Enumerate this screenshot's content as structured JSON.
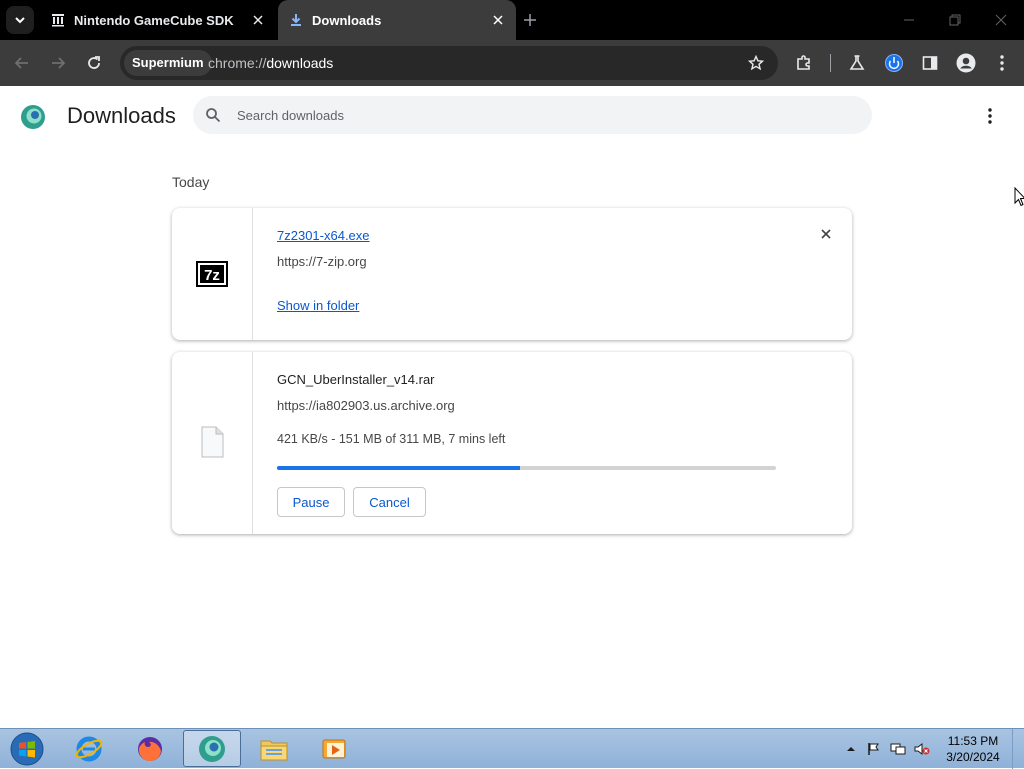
{
  "browser": {
    "tabs": [
      {
        "title": "Nintendo GameCube SDK : Fre",
        "active": false
      },
      {
        "title": "Downloads",
        "active": true
      }
    ],
    "omnibox": {
      "chip": "Supermium",
      "scheme": "chrome://",
      "host": "downloads"
    }
  },
  "page": {
    "title": "Downloads",
    "search_placeholder": "Search downloads",
    "section_label": "Today",
    "downloads": [
      {
        "filename": "7z2301-x64.exe",
        "source": "https://7-zip.org",
        "action_label": "Show in folder",
        "icon": "7zip-file-icon"
      },
      {
        "filename": "GCN_UberInstaller_v14.rar",
        "source": "https://ia802903.us.archive.org",
        "status": "421 KB/s - 151 MB of 311 MB, 7 mins left",
        "progress_percent": 48.6,
        "pause_label": "Pause",
        "cancel_label": "Cancel",
        "icon": "generic-file-icon"
      }
    ]
  },
  "taskbar": {
    "apps": [
      "internet-explorer-icon",
      "firefox-icon",
      "supermium-icon",
      "file-explorer-icon",
      "media-player-icon"
    ],
    "clock_time": "11:53 PM",
    "clock_date": "3/20/2024"
  },
  "colors": {
    "accent": "#0b57d0",
    "progress": "#1a73e8",
    "tabstrip": "#000000",
    "toolbar": "#3c3c3c"
  }
}
